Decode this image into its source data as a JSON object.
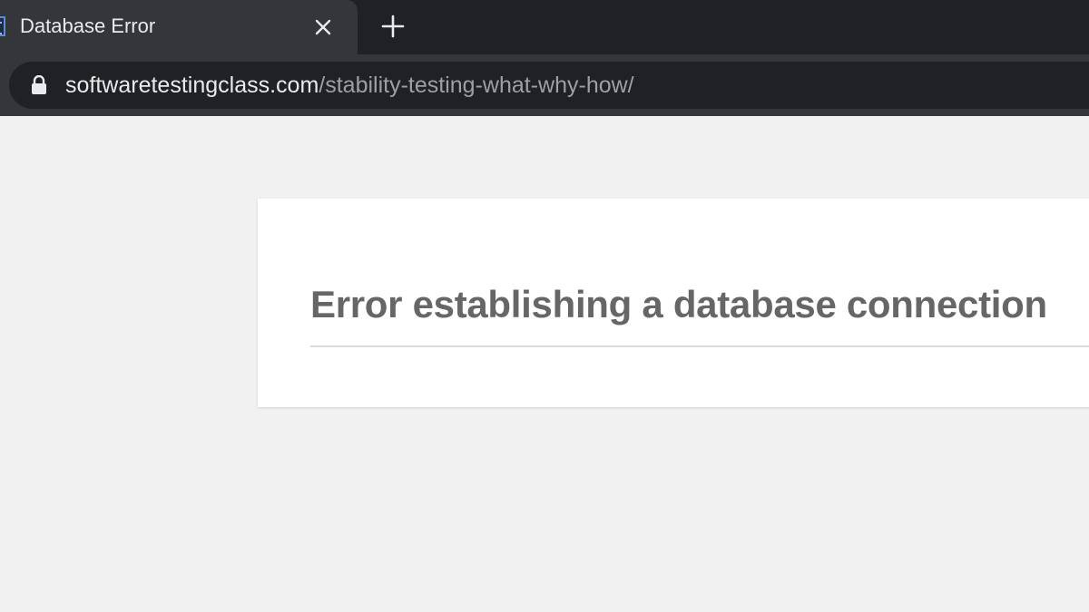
{
  "browser": {
    "tab": {
      "title": "Database Error",
      "close_icon": "close-icon",
      "favicon": "page-favicon"
    },
    "new_tab_icon": "plus-icon",
    "address_bar": {
      "lock_icon": "lock-icon",
      "url_host": "softwaretestingclass.com",
      "url_path": "/stability-testing-what-why-how/"
    },
    "colors": {
      "frame": "#202124",
      "active_tab": "#35363a",
      "text": "#e8eaed",
      "muted_text": "#9aa0a6"
    }
  },
  "page": {
    "error_heading": "Error establishing a database connection",
    "colors": {
      "background": "#f1f1f1",
      "panel": "#ffffff",
      "heading": "#666666"
    }
  }
}
